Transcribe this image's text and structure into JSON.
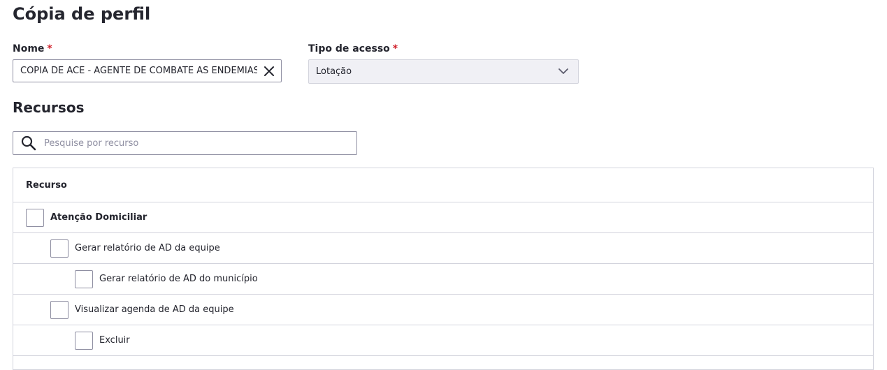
{
  "page": {
    "title": "Cópia de perfil"
  },
  "form": {
    "name_label": "Nome",
    "name_value": "CÓPIA DE ACE - AGENTE DE COMBATE ÀS ENDEMIAS",
    "access_label": "Tipo de acesso",
    "access_value": "Lotação",
    "required_mark": "*"
  },
  "resources": {
    "title": "Recursos",
    "search_placeholder": "Pesquise por recurso",
    "column_header": "Recurso",
    "rows": [
      {
        "label": "Atenção Domiciliar",
        "level": 0,
        "checked": false
      },
      {
        "label": "Gerar relatório de AD da equipe",
        "level": 1,
        "checked": false
      },
      {
        "label": "Gerar relatório de AD do município",
        "level": 2,
        "checked": false
      },
      {
        "label": "Visualizar agenda de AD da equipe",
        "level": 1,
        "checked": false
      },
      {
        "label": "Excluir",
        "level": 2,
        "checked": false
      }
    ]
  },
  "icons": {
    "clear": "close-icon",
    "dropdown": "chevron-down-icon",
    "search": "search-icon"
  },
  "colors": {
    "text": "#24252e",
    "required": "#d01e29",
    "border": "#8f8fa2",
    "divider": "#d3d4dd",
    "disabled_bg": "#f0f0f5"
  }
}
